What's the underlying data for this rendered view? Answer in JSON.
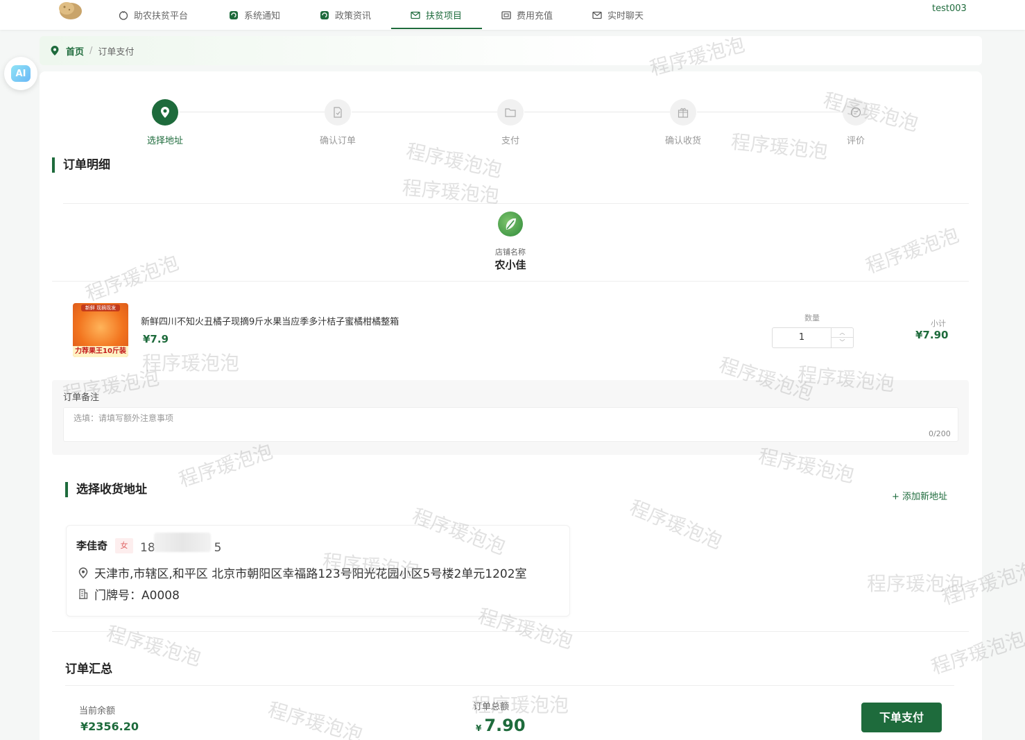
{
  "nav": {
    "items": [
      {
        "label": "助农扶贫平台",
        "icon": "tv-icon"
      },
      {
        "label": "系统通知",
        "icon": "message-icon"
      },
      {
        "label": "政策资讯",
        "icon": "message-icon"
      },
      {
        "label": "扶贫项目",
        "icon": "mail-icon",
        "active": true
      },
      {
        "label": "费用充值",
        "icon": "wallet-icon"
      },
      {
        "label": "实时聊天",
        "icon": "mail-icon"
      }
    ],
    "user": "test003"
  },
  "ai_button": "AI",
  "breadcrumb": {
    "home": "首页",
    "separator": "/",
    "current": "订单支付"
  },
  "steps": [
    {
      "label": "选择地址",
      "active": true
    },
    {
      "label": "确认订单"
    },
    {
      "label": "支付"
    },
    {
      "label": "确认收货"
    },
    {
      "label": "评价"
    }
  ],
  "order_detail": {
    "title": "订单明细",
    "shop_label": "店铺名称",
    "shop_name": "农小佳",
    "product": {
      "image_tag_top": "新鲜 现摘现发",
      "image_tag_bottom": "力荐果王10斤装",
      "name": "新鲜四川不知火丑橘子现摘9斤水果当应季多汁桔子蜜橘柑橘整箱",
      "price": "¥7.9",
      "qty_label": "数量",
      "qty": "1",
      "subtotal_label": "小计",
      "subtotal": "¥7.90"
    },
    "note_label": "订单备注",
    "note_placeholder": "选填：请填写额外注意事项",
    "note_count": "0/200"
  },
  "address": {
    "title": "选择收货地址",
    "add_label": "+ 添加新地址",
    "name": "李佳奇",
    "sex": "女",
    "phone": "18　　　　　5",
    "full": "天津市,市辖区,和平区 北京市朝阳区幸福路123号阳光花园小区5号楼2单元1202室",
    "door": "门牌号：A0008"
  },
  "summary": {
    "title": "订单汇总",
    "balance_label": "当前余额",
    "balance": "¥2356.20",
    "total_label": "订单总额",
    "total_currency": "¥",
    "total": "7.90",
    "pay_button": "下单支付"
  },
  "watermark": "程序瑗泡泡",
  "colors": {
    "accent": "#1e6b3c",
    "price": "#1e6b3c",
    "sex_badge": "#e06666"
  }
}
